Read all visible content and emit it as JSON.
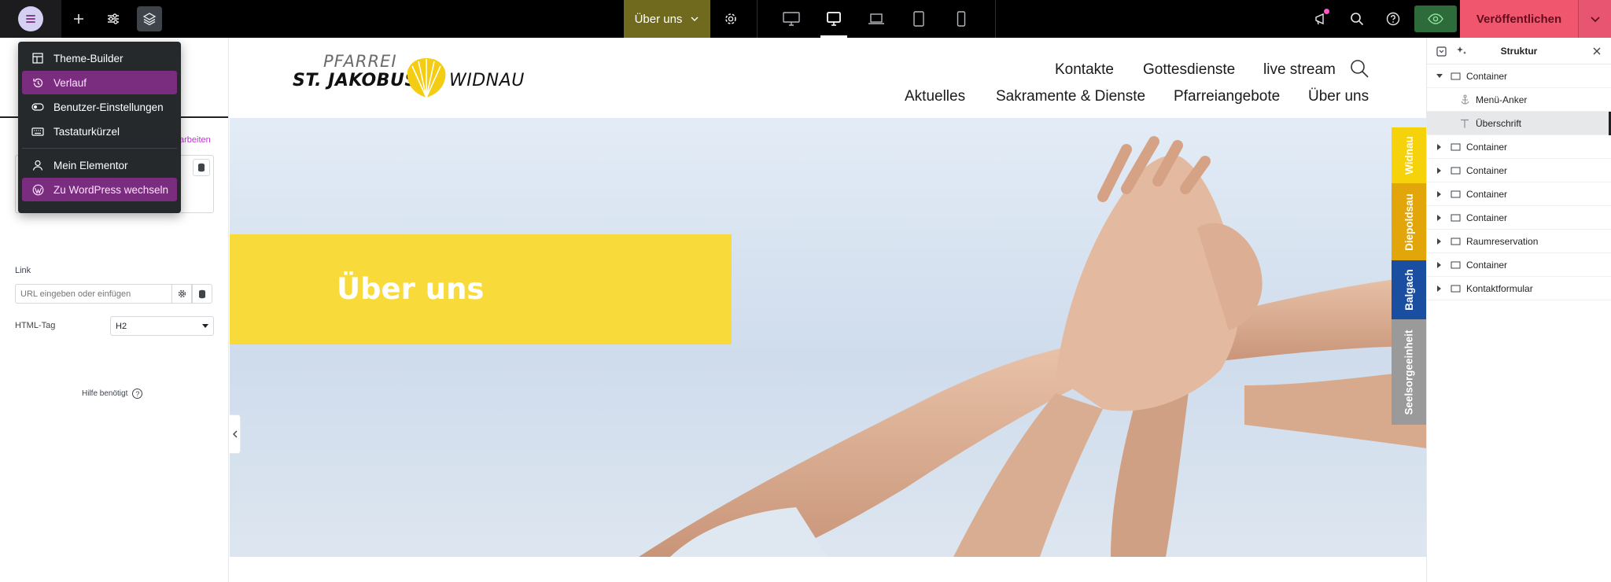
{
  "topbar": {
    "page_selector_label": "Über uns",
    "publish_label": "Veröffentlichen",
    "colors": {
      "page_selector_bg": "#6f6a1e",
      "publish_bg": "#f0576f",
      "preview_bg": "#2d6b3a"
    }
  },
  "dropdown_menu": {
    "items": [
      {
        "label": "Theme-Builder",
        "icon": "theme-builder-icon",
        "highlighted": false
      },
      {
        "label": "Verlauf",
        "icon": "history-icon",
        "highlighted": true
      },
      {
        "label": "Benutzer-Einstellungen",
        "icon": "toggle-icon",
        "highlighted": false
      },
      {
        "label": "Tastaturkürzel",
        "icon": "keyboard-icon",
        "highlighted": false
      },
      {
        "label": "Mein Elementor",
        "icon": "user-icon",
        "highlighted": false
      },
      {
        "label": "Zu WordPress wechseln",
        "icon": "wordpress-icon",
        "highlighted": true
      }
    ]
  },
  "left_panel": {
    "edit_link_text": "arbeiten",
    "link_label": "Link",
    "url_placeholder": "URL eingeben oder einfügen",
    "html_tag_label": "HTML-Tag",
    "html_tag_value": "H2",
    "help_text": "Hilfe benötigt"
  },
  "website": {
    "logo": {
      "line1": "PFARREI",
      "line2": "ST. JAKOBUS",
      "line3": "WIDNAU"
    },
    "nav_top": [
      "Kontakte",
      "Gottesdienste",
      "live stream"
    ],
    "nav_bottom": [
      "Aktuelles",
      "Sakramente & Dienste",
      "Pfarreiangebote",
      "Über uns"
    ],
    "hero_title": "Über uns",
    "side_tabs": [
      {
        "label": "Widnau",
        "color": "#f6d20b"
      },
      {
        "label": "Diepoldsau",
        "color": "#e2a50a"
      },
      {
        "label": "Balgach",
        "color": "#1a4ea0"
      },
      {
        "label": "Seelsorgeeinheit",
        "color": "#9a9a9a"
      }
    ],
    "colors": {
      "hero_box": "#f9da3b",
      "logo_shell": "#f4cd12"
    }
  },
  "structure_panel": {
    "title": "Struktur",
    "items": [
      {
        "label": "Container",
        "depth": 0,
        "expanded": true,
        "selected": false,
        "icon": "container-icon"
      },
      {
        "label": "Menü-Anker",
        "depth": 1,
        "expanded": false,
        "selected": false,
        "icon": "anchor-icon"
      },
      {
        "label": "Überschrift",
        "depth": 1,
        "expanded": false,
        "selected": true,
        "icon": "heading-icon"
      },
      {
        "label": "Container",
        "depth": 0,
        "expanded": false,
        "selected": false,
        "icon": "container-icon"
      },
      {
        "label": "Container",
        "depth": 0,
        "expanded": false,
        "selected": false,
        "icon": "container-icon"
      },
      {
        "label": "Container",
        "depth": 0,
        "expanded": false,
        "selected": false,
        "icon": "container-icon"
      },
      {
        "label": "Container",
        "depth": 0,
        "expanded": false,
        "selected": false,
        "icon": "container-icon"
      },
      {
        "label": "Raumreservation",
        "depth": 0,
        "expanded": false,
        "selected": false,
        "icon": "container-icon"
      },
      {
        "label": "Container",
        "depth": 0,
        "expanded": false,
        "selected": false,
        "icon": "container-icon"
      },
      {
        "label": "Kontaktformular",
        "depth": 0,
        "expanded": false,
        "selected": false,
        "icon": "container-icon"
      }
    ]
  }
}
